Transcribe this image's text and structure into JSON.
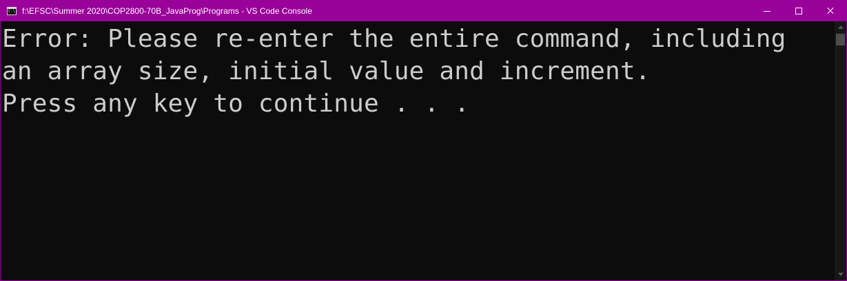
{
  "window": {
    "title": "f:\\EFSC\\Summer 2020\\COP2800-70B_JavaProg\\Programs - VS Code Console",
    "icon_text": "C:\\.",
    "icon": "console-icon",
    "controls": {
      "minimize_icon": "minimize-icon",
      "maximize_icon": "maximize-icon",
      "close_icon": "close-icon"
    },
    "colors": {
      "titlebar": "#9a009a",
      "console_bg": "#0c0c0c",
      "console_text": "#cccccc"
    }
  },
  "console": {
    "lines": [
      "Error: Please re-enter the entire command, including",
      "an array size, initial value and increment.",
      "Press any key to continue . . ."
    ]
  }
}
